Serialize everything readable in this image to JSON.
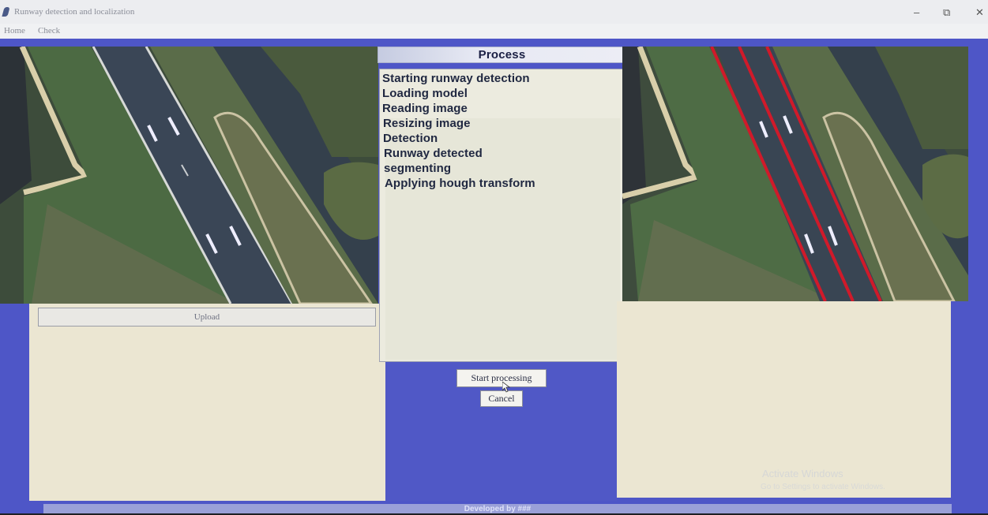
{
  "window": {
    "title": "Runway detection and localization",
    "controls": {
      "minimize": "–",
      "restore": "⧉",
      "close": "✕"
    }
  },
  "menu": {
    "items": [
      "Home",
      "Check"
    ]
  },
  "process": {
    "header": "Process",
    "log": [
      "Starting runway detection",
      "Loading model",
      "Reading image",
      "Resizing image",
      "Detection",
      "Runway detected",
      "segmenting",
      "Applying hough transform"
    ]
  },
  "buttons": {
    "upload": "Upload",
    "start": "Start processing",
    "cancel": "Cancel"
  },
  "footer": {
    "text": "Developed by ###"
  },
  "watermark": {
    "line1": "Activate Windows",
    "line2": "Go to Settings to activate Windows."
  },
  "colors": {
    "window_bg": "#4e56c7",
    "panel_cream": "#ebe6d2",
    "detection_line": "#d01a2a"
  },
  "icons": {
    "app": "feather-icon",
    "cursor": "mouse-pointer-icon"
  }
}
